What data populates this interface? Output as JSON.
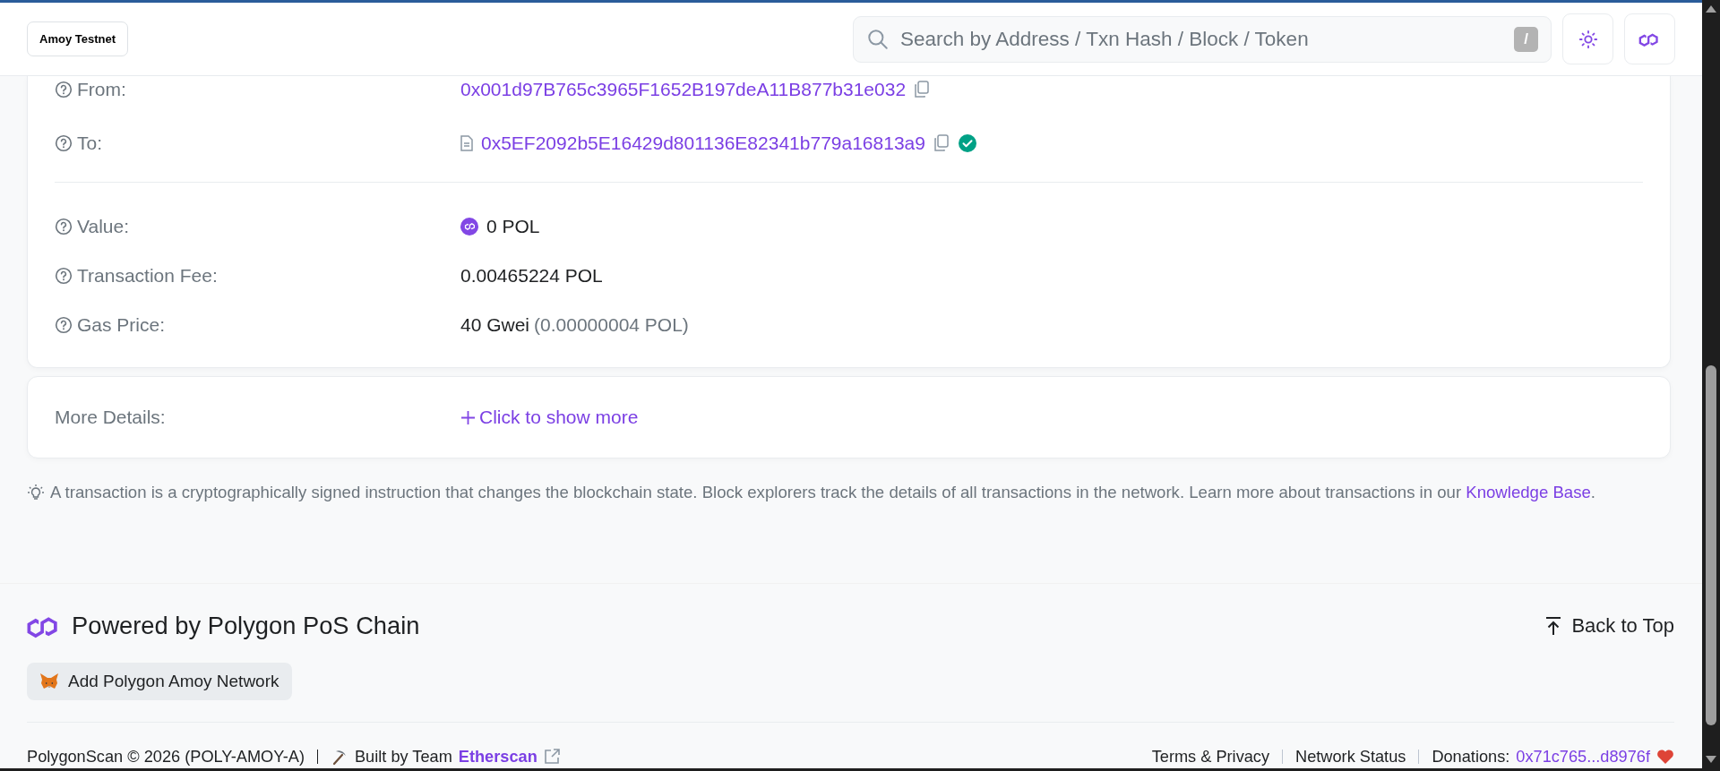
{
  "header": {
    "network_badge": "Amoy Testnet",
    "search": {
      "placeholder": "Search by Address / Txn Hash / Block / Token",
      "shortcut": "/"
    }
  },
  "details": {
    "address_rows": [
      {
        "kind": "address",
        "label": "From:",
        "value": "0x001d97B765c3965F1652B197deA11B877b31e032",
        "verified": false
      },
      {
        "kind": "contract",
        "label": "To:",
        "value": "0x5EF2092b5E16429d801136E82341b779a16813a9",
        "verified": true
      }
    ],
    "amount_rows": [
      {
        "kind": "token",
        "label": "Value:",
        "value": "0 POL"
      },
      {
        "kind": "plain",
        "label": "Transaction Fee:",
        "value": "0.00465224 POL"
      },
      {
        "kind": "gas",
        "label": "Gas Price:",
        "value": "40 Gwei",
        "note": "(0.00000004 POL)"
      }
    ]
  },
  "more_details": {
    "label": "More Details:",
    "link": "Click to show more"
  },
  "info": {
    "text": "A transaction is a cryptographically signed instruction that changes the blockchain state. Block explorers track the details of all transactions in the network. Learn more about transactions in our",
    "link": "Knowledge Base",
    "end": "."
  },
  "footer": {
    "title": "Powered by Polygon PoS Chain",
    "add_network_button": "Add Polygon Amoy Network",
    "back_to_top": "Back to Top",
    "copyright": "PolygonScan © 2026 (POLY-AMOY-A)",
    "built_by": "Built by Team",
    "built_by_link": "Etherscan",
    "links": [
      "Terms & Privacy",
      "Network Status"
    ],
    "donations_label": "Donations:",
    "donations_address": "0x71c765...d8976f"
  }
}
